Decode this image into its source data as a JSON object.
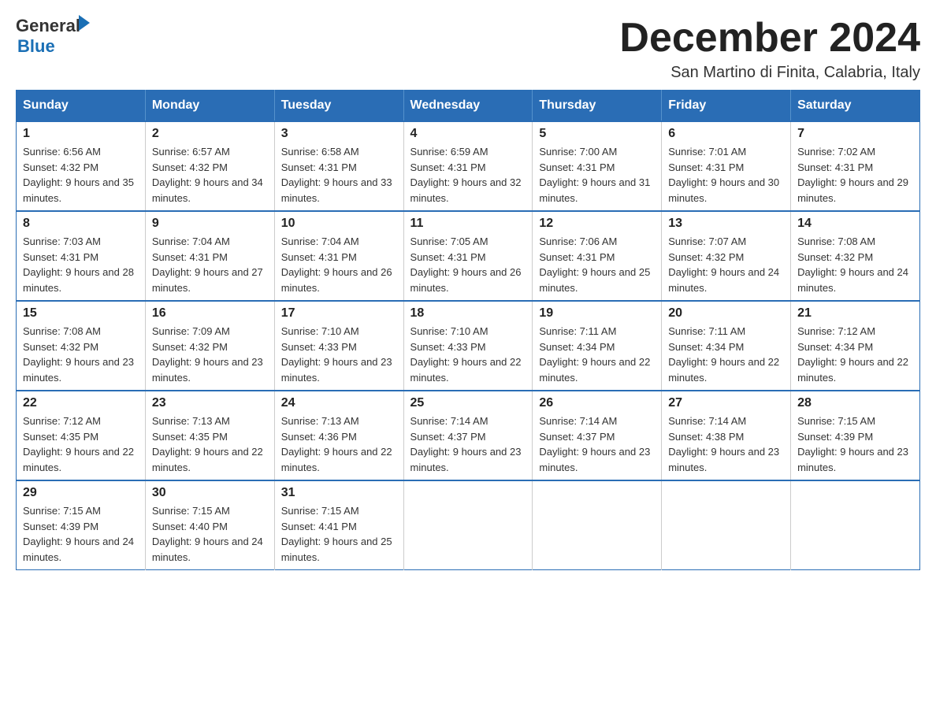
{
  "header": {
    "logo_general": "General",
    "logo_arrow": "▶",
    "logo_blue": "Blue",
    "month_title": "December 2024",
    "location": "San Martino di Finita, Calabria, Italy"
  },
  "weekdays": [
    "Sunday",
    "Monday",
    "Tuesday",
    "Wednesday",
    "Thursday",
    "Friday",
    "Saturday"
  ],
  "weeks": [
    [
      {
        "day": "1",
        "sunrise": "Sunrise: 6:56 AM",
        "sunset": "Sunset: 4:32 PM",
        "daylight": "Daylight: 9 hours and 35 minutes."
      },
      {
        "day": "2",
        "sunrise": "Sunrise: 6:57 AM",
        "sunset": "Sunset: 4:32 PM",
        "daylight": "Daylight: 9 hours and 34 minutes."
      },
      {
        "day": "3",
        "sunrise": "Sunrise: 6:58 AM",
        "sunset": "Sunset: 4:31 PM",
        "daylight": "Daylight: 9 hours and 33 minutes."
      },
      {
        "day": "4",
        "sunrise": "Sunrise: 6:59 AM",
        "sunset": "Sunset: 4:31 PM",
        "daylight": "Daylight: 9 hours and 32 minutes."
      },
      {
        "day": "5",
        "sunrise": "Sunrise: 7:00 AM",
        "sunset": "Sunset: 4:31 PM",
        "daylight": "Daylight: 9 hours and 31 minutes."
      },
      {
        "day": "6",
        "sunrise": "Sunrise: 7:01 AM",
        "sunset": "Sunset: 4:31 PM",
        "daylight": "Daylight: 9 hours and 30 minutes."
      },
      {
        "day": "7",
        "sunrise": "Sunrise: 7:02 AM",
        "sunset": "Sunset: 4:31 PM",
        "daylight": "Daylight: 9 hours and 29 minutes."
      }
    ],
    [
      {
        "day": "8",
        "sunrise": "Sunrise: 7:03 AM",
        "sunset": "Sunset: 4:31 PM",
        "daylight": "Daylight: 9 hours and 28 minutes."
      },
      {
        "day": "9",
        "sunrise": "Sunrise: 7:04 AM",
        "sunset": "Sunset: 4:31 PM",
        "daylight": "Daylight: 9 hours and 27 minutes."
      },
      {
        "day": "10",
        "sunrise": "Sunrise: 7:04 AM",
        "sunset": "Sunset: 4:31 PM",
        "daylight": "Daylight: 9 hours and 26 minutes."
      },
      {
        "day": "11",
        "sunrise": "Sunrise: 7:05 AM",
        "sunset": "Sunset: 4:31 PM",
        "daylight": "Daylight: 9 hours and 26 minutes."
      },
      {
        "day": "12",
        "sunrise": "Sunrise: 7:06 AM",
        "sunset": "Sunset: 4:31 PM",
        "daylight": "Daylight: 9 hours and 25 minutes."
      },
      {
        "day": "13",
        "sunrise": "Sunrise: 7:07 AM",
        "sunset": "Sunset: 4:32 PM",
        "daylight": "Daylight: 9 hours and 24 minutes."
      },
      {
        "day": "14",
        "sunrise": "Sunrise: 7:08 AM",
        "sunset": "Sunset: 4:32 PM",
        "daylight": "Daylight: 9 hours and 24 minutes."
      }
    ],
    [
      {
        "day": "15",
        "sunrise": "Sunrise: 7:08 AM",
        "sunset": "Sunset: 4:32 PM",
        "daylight": "Daylight: 9 hours and 23 minutes."
      },
      {
        "day": "16",
        "sunrise": "Sunrise: 7:09 AM",
        "sunset": "Sunset: 4:32 PM",
        "daylight": "Daylight: 9 hours and 23 minutes."
      },
      {
        "day": "17",
        "sunrise": "Sunrise: 7:10 AM",
        "sunset": "Sunset: 4:33 PM",
        "daylight": "Daylight: 9 hours and 23 minutes."
      },
      {
        "day": "18",
        "sunrise": "Sunrise: 7:10 AM",
        "sunset": "Sunset: 4:33 PM",
        "daylight": "Daylight: 9 hours and 22 minutes."
      },
      {
        "day": "19",
        "sunrise": "Sunrise: 7:11 AM",
        "sunset": "Sunset: 4:34 PM",
        "daylight": "Daylight: 9 hours and 22 minutes."
      },
      {
        "day": "20",
        "sunrise": "Sunrise: 7:11 AM",
        "sunset": "Sunset: 4:34 PM",
        "daylight": "Daylight: 9 hours and 22 minutes."
      },
      {
        "day": "21",
        "sunrise": "Sunrise: 7:12 AM",
        "sunset": "Sunset: 4:34 PM",
        "daylight": "Daylight: 9 hours and 22 minutes."
      }
    ],
    [
      {
        "day": "22",
        "sunrise": "Sunrise: 7:12 AM",
        "sunset": "Sunset: 4:35 PM",
        "daylight": "Daylight: 9 hours and 22 minutes."
      },
      {
        "day": "23",
        "sunrise": "Sunrise: 7:13 AM",
        "sunset": "Sunset: 4:35 PM",
        "daylight": "Daylight: 9 hours and 22 minutes."
      },
      {
        "day": "24",
        "sunrise": "Sunrise: 7:13 AM",
        "sunset": "Sunset: 4:36 PM",
        "daylight": "Daylight: 9 hours and 22 minutes."
      },
      {
        "day": "25",
        "sunrise": "Sunrise: 7:14 AM",
        "sunset": "Sunset: 4:37 PM",
        "daylight": "Daylight: 9 hours and 23 minutes."
      },
      {
        "day": "26",
        "sunrise": "Sunrise: 7:14 AM",
        "sunset": "Sunset: 4:37 PM",
        "daylight": "Daylight: 9 hours and 23 minutes."
      },
      {
        "day": "27",
        "sunrise": "Sunrise: 7:14 AM",
        "sunset": "Sunset: 4:38 PM",
        "daylight": "Daylight: 9 hours and 23 minutes."
      },
      {
        "day": "28",
        "sunrise": "Sunrise: 7:15 AM",
        "sunset": "Sunset: 4:39 PM",
        "daylight": "Daylight: 9 hours and 23 minutes."
      }
    ],
    [
      {
        "day": "29",
        "sunrise": "Sunrise: 7:15 AM",
        "sunset": "Sunset: 4:39 PM",
        "daylight": "Daylight: 9 hours and 24 minutes."
      },
      {
        "day": "30",
        "sunrise": "Sunrise: 7:15 AM",
        "sunset": "Sunset: 4:40 PM",
        "daylight": "Daylight: 9 hours and 24 minutes."
      },
      {
        "day": "31",
        "sunrise": "Sunrise: 7:15 AM",
        "sunset": "Sunset: 4:41 PM",
        "daylight": "Daylight: 9 hours and 25 minutes."
      },
      null,
      null,
      null,
      null
    ]
  ]
}
